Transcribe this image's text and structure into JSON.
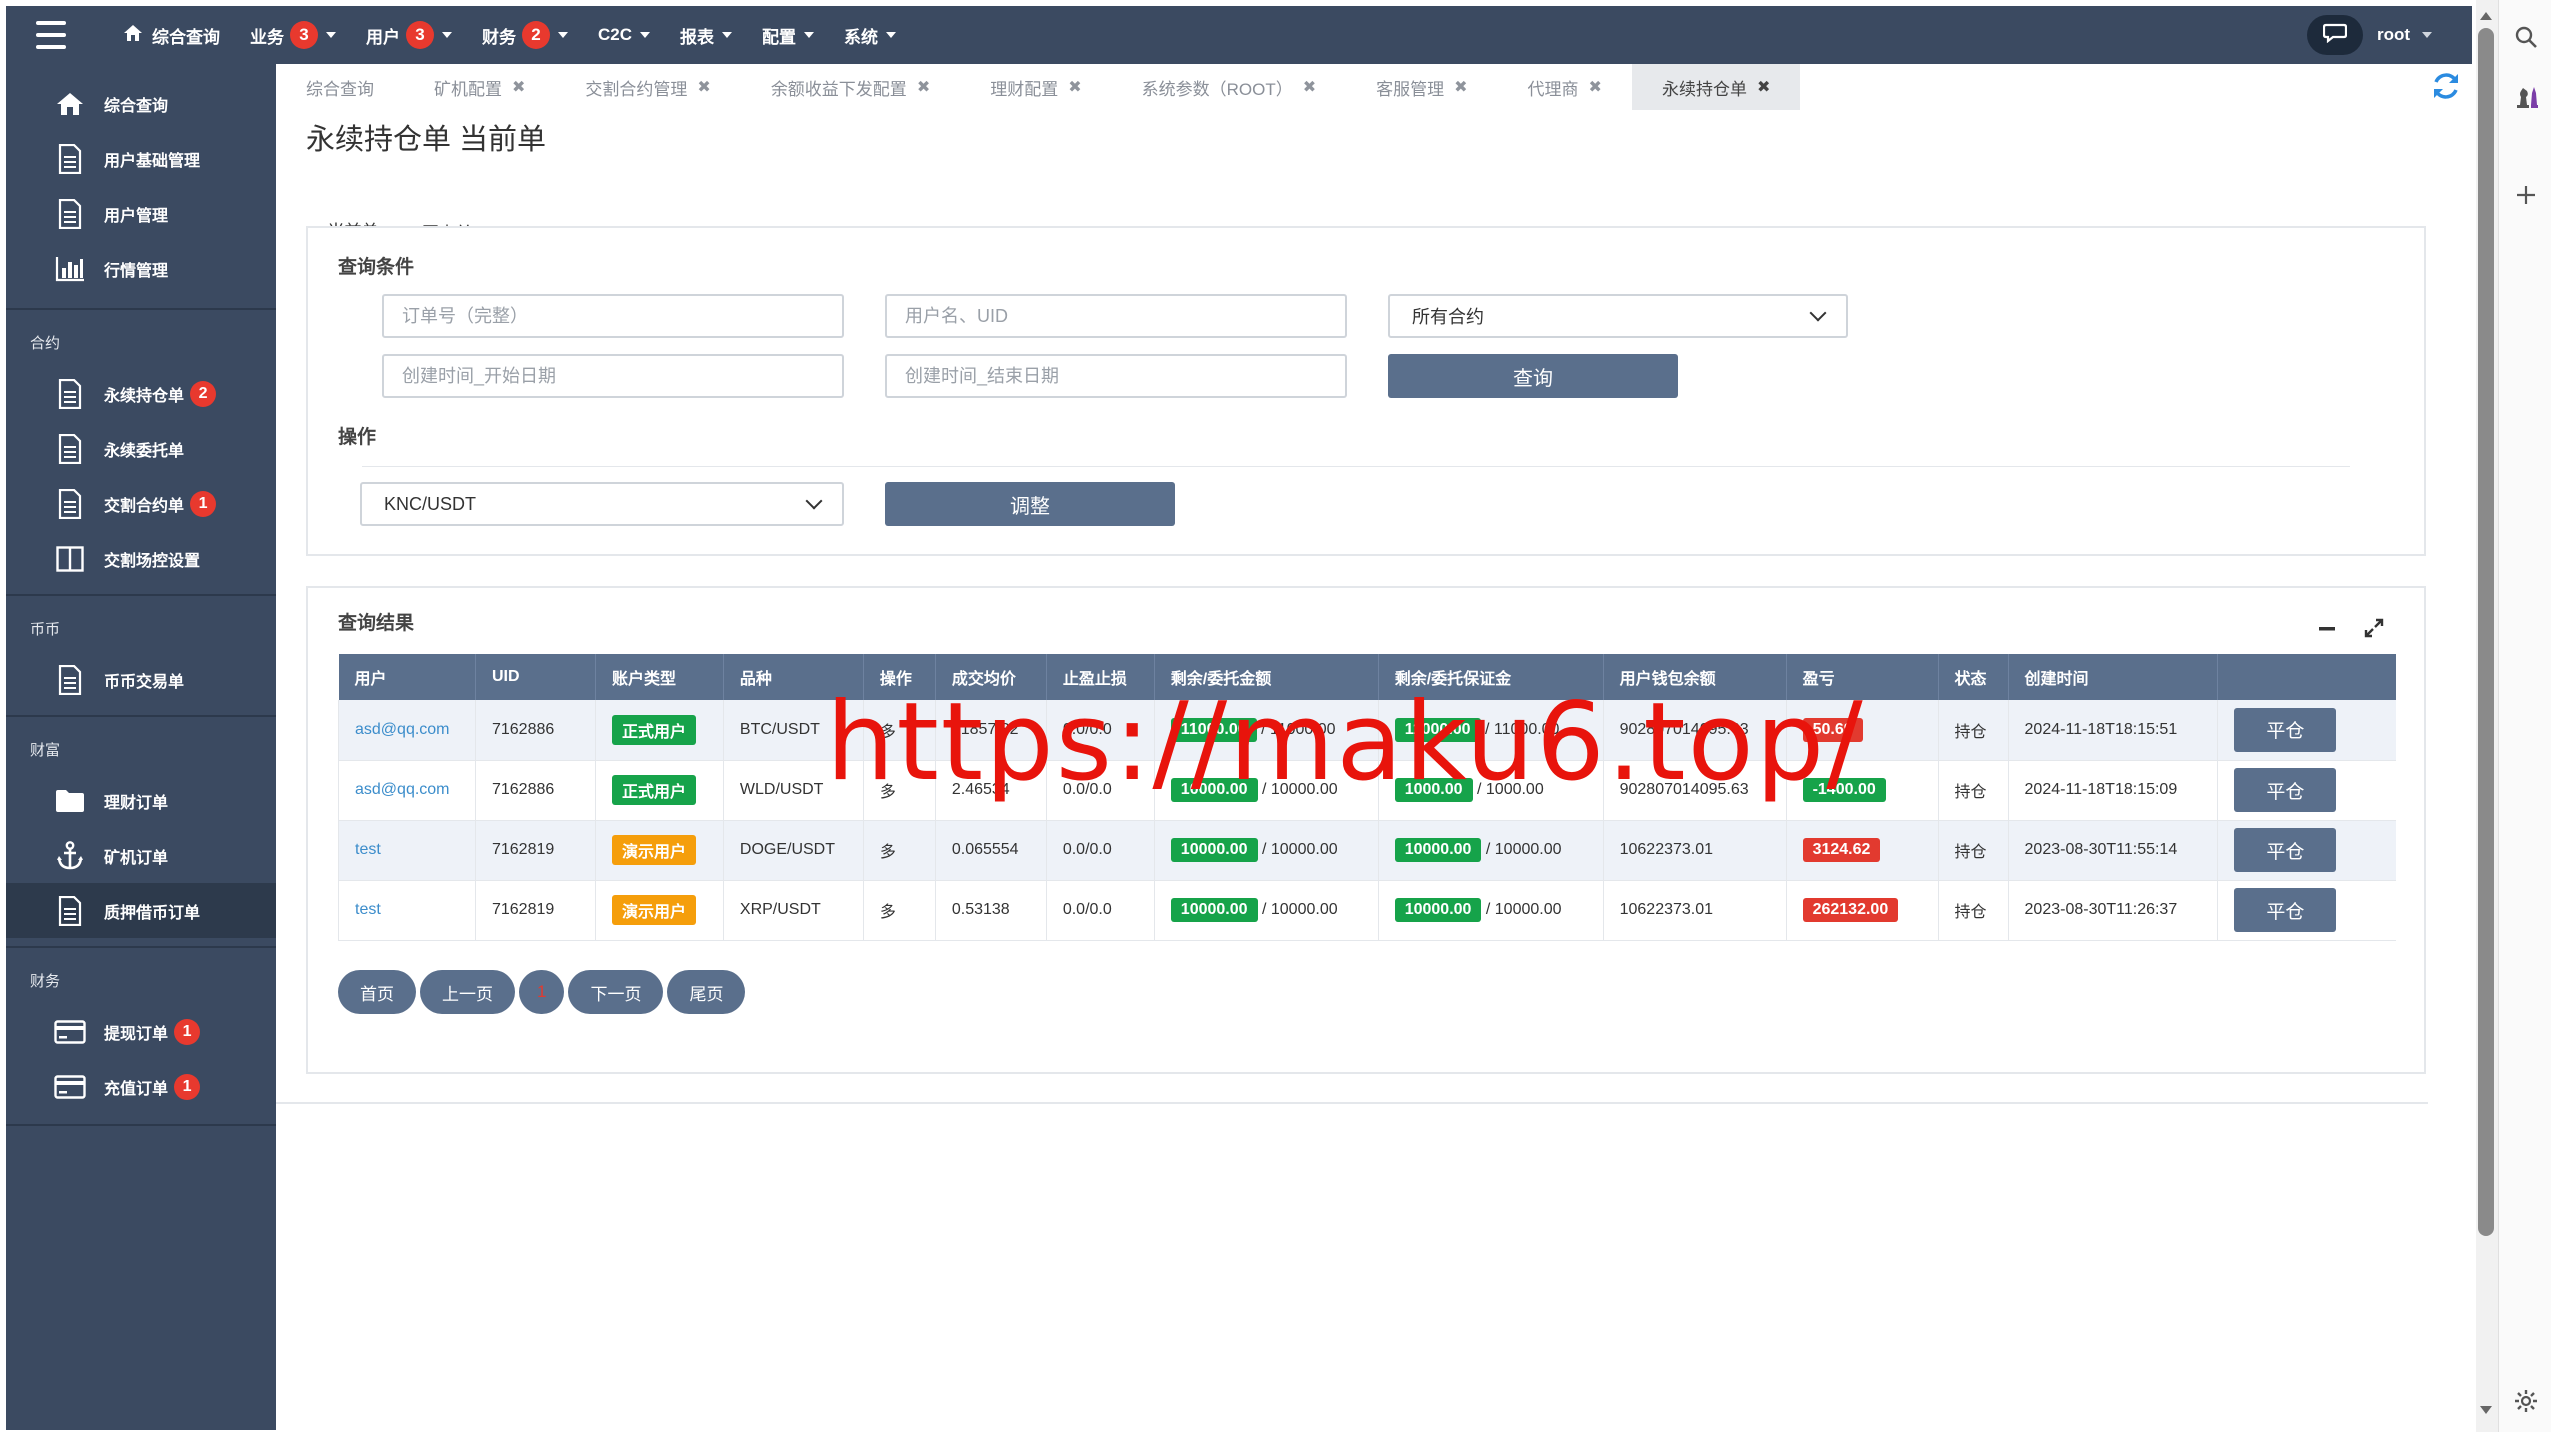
{
  "topnav": {
    "items": [
      {
        "label": "综合查询",
        "badge": null
      },
      {
        "label": "业务",
        "badge": "3"
      },
      {
        "label": "用户",
        "badge": "3"
      },
      {
        "label": "财务",
        "badge": "2"
      },
      {
        "label": "C2C",
        "badge": null
      },
      {
        "label": "报表",
        "badge": null
      },
      {
        "label": "配置",
        "badge": null
      },
      {
        "label": "系统",
        "badge": null
      }
    ],
    "user": "root"
  },
  "sidebar": {
    "group0": [
      {
        "label": "综合查询"
      },
      {
        "label": "用户基础管理"
      },
      {
        "label": "用户管理"
      },
      {
        "label": "行情管理"
      }
    ],
    "group1": {
      "title": "合约",
      "items": [
        {
          "label": "永续持仓单",
          "badge": "2"
        },
        {
          "label": "永续委托单",
          "badge": null
        },
        {
          "label": "交割合约单",
          "badge": "1"
        },
        {
          "label": "交割场控设置",
          "badge": null
        }
      ]
    },
    "group2": {
      "title": "币币",
      "items": [
        {
          "label": "币币交易单"
        }
      ]
    },
    "group3": {
      "title": "财富",
      "items": [
        {
          "label": "理财订单"
        },
        {
          "label": "矿机订单"
        },
        {
          "label": "质押借币订单"
        }
      ]
    },
    "group4": {
      "title": "财务",
      "items": [
        {
          "label": "提现订单",
          "badge": "1"
        },
        {
          "label": "充值订单",
          "badge": "1"
        }
      ]
    }
  },
  "tabs": [
    {
      "label": "综合查询",
      "closable": false
    },
    {
      "label": "矿机配置",
      "closable": true
    },
    {
      "label": "交割合约管理",
      "closable": true
    },
    {
      "label": "余额收益下发配置",
      "closable": true
    },
    {
      "label": "理财配置",
      "closable": true
    },
    {
      "label": "系统参数（ROOT）",
      "closable": true
    },
    {
      "label": "客服管理",
      "closable": true
    },
    {
      "label": "代理商",
      "closable": true
    },
    {
      "label": "永续持仓单",
      "closable": true
    }
  ],
  "tab_close_glyph": "✖",
  "page_title": "永续持仓单 当前单",
  "subtabs": {
    "current": "当前单",
    "history": "历史单"
  },
  "query": {
    "title": "查询条件",
    "order_placeholder": "订单号（完整）",
    "user_placeholder": "用户名、UID",
    "contract_select": "所有合约",
    "start_placeholder": "创建时间_开始日期",
    "end_placeholder": "创建时间_结束日期",
    "search_label": "查询"
  },
  "ops": {
    "title": "操作",
    "pair_select": "KNC/USDT",
    "adjust_label": "调整"
  },
  "results": {
    "title": "查询结果",
    "columns": [
      "用户",
      "UID",
      "账户类型",
      "品种",
      "操作",
      "成交均价",
      "止盈止损",
      "剩余/委托金额",
      "剩余/委托保证金",
      "用户钱包余额",
      "盈亏",
      "状态",
      "创建时间",
      ""
    ],
    "rows": [
      {
        "user": "asd@qq.com",
        "uid": "7162886",
        "acct": "正式用户",
        "acct_type": "formal",
        "pair": "BTC/USDT",
        "side": "多",
        "avg": "91857.32",
        "tpsl": "0.0/0.0",
        "amt_rem": "11000.00",
        "amt_total": "/ 11000.00",
        "margin_rem": "11000.00",
        "margin_total": "/ 11000.00",
        "wallet": "902807014095.63",
        "pnl": "50.69",
        "pnl_sign": "pos",
        "status": "持仓",
        "time": "2024-11-18T18:15:51",
        "action": "平仓"
      },
      {
        "user": "asd@qq.com",
        "uid": "7162886",
        "acct": "正式用户",
        "acct_type": "formal",
        "pair": "WLD/USDT",
        "side": "多",
        "avg": "2.46534",
        "tpsl": "0.0/0.0",
        "amt_rem": "10000.00",
        "amt_total": "/ 10000.00",
        "margin_rem": "1000.00",
        "margin_total": "/ 1000.00",
        "wallet": "902807014095.63",
        "pnl": "-1400.00",
        "pnl_sign": "neg",
        "status": "持仓",
        "time": "2024-11-18T18:15:09",
        "action": "平仓"
      },
      {
        "user": "test",
        "uid": "7162819",
        "acct": "演示用户",
        "acct_type": "demo",
        "pair": "DOGE/USDT",
        "side": "多",
        "avg": "0.065554",
        "tpsl": "0.0/0.0",
        "amt_rem": "10000.00",
        "amt_total": "/ 10000.00",
        "margin_rem": "10000.00",
        "margin_total": "/ 10000.00",
        "wallet": "10622373.01",
        "pnl": "3124.62",
        "pnl_sign": "pos",
        "status": "持仓",
        "time": "2023-08-30T11:55:14",
        "action": "平仓"
      },
      {
        "user": "test",
        "uid": "7162819",
        "acct": "演示用户",
        "acct_type": "demo",
        "pair": "XRP/USDT",
        "side": "多",
        "avg": "0.53138",
        "tpsl": "0.0/0.0",
        "amt_rem": "10000.00",
        "amt_total": "/ 10000.00",
        "margin_rem": "10000.00",
        "margin_total": "/ 10000.00",
        "wallet": "10622373.01",
        "pnl": "262132.00",
        "pnl_sign": "pos",
        "status": "持仓",
        "time": "2023-08-30T11:26:37",
        "action": "平仓"
      }
    ]
  },
  "pager": {
    "first": "首页",
    "prev": "上一页",
    "current": "1",
    "next": "下一页",
    "last": "尾页"
  },
  "watermark": "https://maku6.top/",
  "colors": {
    "nav_bg": "#3b4a61",
    "button": "#5a6f8c",
    "badge": "#e8392e",
    "green": "#16a34a",
    "orange": "#f59e0b",
    "red": "#e23a2f",
    "link": "#3c8dcb"
  }
}
